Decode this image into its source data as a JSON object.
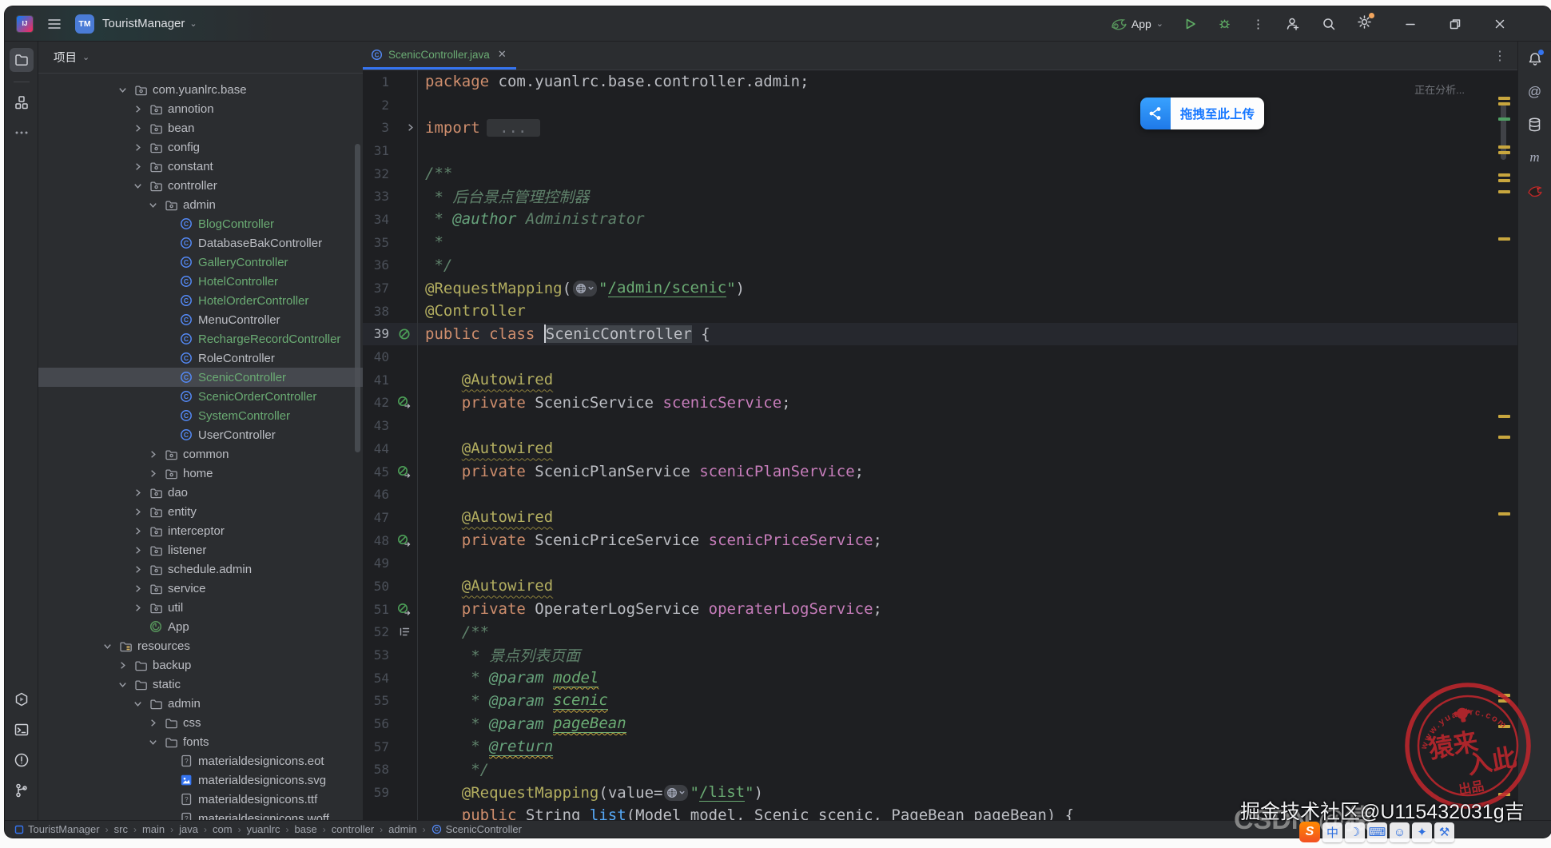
{
  "title_bar": {
    "app_icon_text": "IJ",
    "badge": "TM",
    "project_name": "TouristManager",
    "run_config": "App",
    "analyzing": "正在分析..."
  },
  "project": {
    "header": "项目",
    "tree": [
      {
        "l": "com.yuanlrc.base",
        "v": 1,
        "c": "o",
        "i": "pkg"
      },
      {
        "l": "annotion",
        "v": 2,
        "c": "c",
        "i": "pkg"
      },
      {
        "l": "bean",
        "v": 2,
        "c": "c",
        "i": "pkg"
      },
      {
        "l": "config",
        "v": 2,
        "c": "c",
        "i": "pkg"
      },
      {
        "l": "constant",
        "v": 2,
        "c": "c",
        "i": "pkg"
      },
      {
        "l": "controller",
        "v": 2,
        "c": "o",
        "i": "pkg"
      },
      {
        "l": "admin",
        "v": 3,
        "c": "o",
        "i": "pkg"
      },
      {
        "l": "BlogController",
        "v": 4,
        "c": "",
        "i": "cls",
        "g": true
      },
      {
        "l": "DatabaseBakController",
        "v": 4,
        "c": "",
        "i": "cls"
      },
      {
        "l": "GalleryController",
        "v": 4,
        "c": "",
        "i": "cls",
        "g": true
      },
      {
        "l": "HotelController",
        "v": 4,
        "c": "",
        "i": "cls",
        "g": true
      },
      {
        "l": "HotelOrderController",
        "v": 4,
        "c": "",
        "i": "cls",
        "g": true
      },
      {
        "l": "MenuController",
        "v": 4,
        "c": "",
        "i": "cls"
      },
      {
        "l": "RechargeRecordController",
        "v": 4,
        "c": "",
        "i": "cls",
        "g": true
      },
      {
        "l": "RoleController",
        "v": 4,
        "c": "",
        "i": "cls"
      },
      {
        "l": "ScenicController",
        "v": 4,
        "c": "",
        "i": "cls",
        "g": true,
        "sel": true
      },
      {
        "l": "ScenicOrderController",
        "v": 4,
        "c": "",
        "i": "cls",
        "g": true
      },
      {
        "l": "SystemController",
        "v": 4,
        "c": "",
        "i": "cls",
        "g": true
      },
      {
        "l": "UserController",
        "v": 4,
        "c": "",
        "i": "cls"
      },
      {
        "l": "common",
        "v": 3,
        "c": "c",
        "i": "pkg"
      },
      {
        "l": "home",
        "v": 3,
        "c": "c",
        "i": "pkg"
      },
      {
        "l": "dao",
        "v": 2,
        "c": "c",
        "i": "pkg"
      },
      {
        "l": "entity",
        "v": 2,
        "c": "c",
        "i": "pkg"
      },
      {
        "l": "interceptor",
        "v": 2,
        "c": "c",
        "i": "pkg"
      },
      {
        "l": "listener",
        "v": 2,
        "c": "c",
        "i": "pkg"
      },
      {
        "l": "schedule.admin",
        "v": 2,
        "c": "c",
        "i": "pkg"
      },
      {
        "l": "service",
        "v": 2,
        "c": "c",
        "i": "pkg"
      },
      {
        "l": "util",
        "v": 2,
        "c": "c",
        "i": "pkg"
      },
      {
        "l": "App",
        "v": 2,
        "c": "",
        "i": "boot"
      },
      {
        "l": "resources",
        "v": 0,
        "c": "o",
        "i": "res"
      },
      {
        "l": "backup",
        "v": 1,
        "c": "c",
        "i": "fold"
      },
      {
        "l": "static",
        "v": 1,
        "c": "o",
        "i": "fold"
      },
      {
        "l": "admin",
        "v": 2,
        "c": "o",
        "i": "fold"
      },
      {
        "l": "css",
        "v": 3,
        "c": "c",
        "i": "fold"
      },
      {
        "l": "fonts",
        "v": 3,
        "c": "o",
        "i": "fold"
      },
      {
        "l": "materialdesignicons.eot",
        "v": 4,
        "c": "",
        "i": "fq"
      },
      {
        "l": "materialdesignicons.svg",
        "v": 4,
        "c": "",
        "i": "fi"
      },
      {
        "l": "materialdesignicons.ttf",
        "v": 4,
        "c": "",
        "i": "fq"
      },
      {
        "l": "materialdesignicons.woff",
        "v": 4,
        "c": "",
        "i": "fq"
      }
    ]
  },
  "editor": {
    "tab_label": "ScenicController.java",
    "lines": [
      {
        "n": "1",
        "g": "",
        "s": [
          [
            "kw",
            "package"
          ],
          [
            "pl",
            " com.yuanlrc.base.controller.admin;"
          ]
        ]
      },
      {
        "n": "2",
        "g": "",
        "s": []
      },
      {
        "n": "3",
        "g": "fold",
        "s": [
          [
            "kw",
            "import"
          ],
          [
            "box",
            " ... "
          ]
        ]
      },
      {
        "n": "31",
        "g": "",
        "s": []
      },
      {
        "n": "32",
        "g": "",
        "s": [
          [
            "doc",
            "/**"
          ]
        ]
      },
      {
        "n": "33",
        "g": "",
        "s": [
          [
            "doc",
            " * 后台景点管理控制器"
          ]
        ]
      },
      {
        "n": "34",
        "g": "",
        "s": [
          [
            "doc",
            " * "
          ],
          [
            "dtag",
            "@author"
          ],
          [
            "doc",
            " "
          ],
          [
            "dval",
            "Administrator"
          ]
        ]
      },
      {
        "n": "35",
        "g": "",
        "s": [
          [
            "doc",
            " *"
          ]
        ]
      },
      {
        "n": "36",
        "g": "",
        "s": [
          [
            "doc",
            " */"
          ]
        ]
      },
      {
        "n": "37",
        "g": "",
        "s": [
          [
            "ann",
            "@RequestMapping"
          ],
          [
            "pl",
            "("
          ],
          [
            "ic",
            "globe"
          ],
          [
            "str",
            "\""
          ],
          [
            "stru",
            "/admin/scenic"
          ],
          [
            "str",
            "\""
          ],
          [
            "pl",
            ")"
          ]
        ]
      },
      {
        "n": "38",
        "g": "",
        "s": [
          [
            "ann",
            "@Controller"
          ]
        ]
      },
      {
        "n": "39",
        "g": "bean",
        "cur": true,
        "s": [
          [
            "kw",
            "public"
          ],
          [
            "pl",
            " "
          ],
          [
            "kw",
            "class"
          ],
          [
            "pl",
            " "
          ],
          [
            "ic",
            "caret"
          ],
          [
            "selbox",
            "ScenicController"
          ],
          [
            "pl",
            " {"
          ]
        ]
      },
      {
        "n": "40",
        "g": "",
        "s": []
      },
      {
        "n": "41",
        "g": "",
        "s": [
          [
            "pl",
            "    "
          ],
          [
            "annw",
            "@Autowired"
          ]
        ]
      },
      {
        "n": "42",
        "g": "beanarrow",
        "s": [
          [
            "pl",
            "    "
          ],
          [
            "kw",
            "private"
          ],
          [
            "pl",
            " ScenicService "
          ],
          [
            "fld",
            "scenicService"
          ],
          [
            "pl",
            ";"
          ]
        ]
      },
      {
        "n": "43",
        "g": "",
        "s": []
      },
      {
        "n": "44",
        "g": "",
        "s": [
          [
            "pl",
            "    "
          ],
          [
            "annw",
            "@Autowired"
          ]
        ]
      },
      {
        "n": "45",
        "g": "beanarrow",
        "s": [
          [
            "pl",
            "    "
          ],
          [
            "kw",
            "private"
          ],
          [
            "pl",
            " ScenicPlanService "
          ],
          [
            "fld",
            "scenicPlanService"
          ],
          [
            "pl",
            ";"
          ]
        ]
      },
      {
        "n": "46",
        "g": "",
        "s": []
      },
      {
        "n": "47",
        "g": "",
        "s": [
          [
            "pl",
            "    "
          ],
          [
            "annw",
            "@Autowired"
          ]
        ]
      },
      {
        "n": "48",
        "g": "beanarrow",
        "s": [
          [
            "pl",
            "    "
          ],
          [
            "kw",
            "private"
          ],
          [
            "pl",
            " ScenicPriceService "
          ],
          [
            "fld",
            "scenicPriceService"
          ],
          [
            "pl",
            ";"
          ]
        ]
      },
      {
        "n": "49",
        "g": "",
        "s": []
      },
      {
        "n": "50",
        "g": "",
        "s": [
          [
            "pl",
            "    "
          ],
          [
            "annw",
            "@Autowired"
          ]
        ]
      },
      {
        "n": "51",
        "g": "beanarrow",
        "s": [
          [
            "pl",
            "    "
          ],
          [
            "kw",
            "private"
          ],
          [
            "pl",
            " OperaterLogService "
          ],
          [
            "fld",
            "operaterLogService"
          ],
          [
            "pl",
            ";"
          ]
        ]
      },
      {
        "n": "52",
        "g": "list",
        "s": [
          [
            "doc",
            "    /**"
          ]
        ]
      },
      {
        "n": "53",
        "g": "",
        "s": [
          [
            "doc",
            "     * 景点列表页面"
          ]
        ]
      },
      {
        "n": "54",
        "g": "",
        "s": [
          [
            "doc",
            "     * "
          ],
          [
            "dtag",
            "@param"
          ],
          [
            "doc",
            " "
          ],
          [
            "dparam",
            "model"
          ]
        ]
      },
      {
        "n": "55",
        "g": "",
        "s": [
          [
            "doc",
            "     * "
          ],
          [
            "dtag",
            "@param"
          ],
          [
            "doc",
            " "
          ],
          [
            "dparam",
            "scenic"
          ]
        ]
      },
      {
        "n": "56",
        "g": "",
        "s": [
          [
            "doc",
            "     * "
          ],
          [
            "dtag",
            "@param"
          ],
          [
            "doc",
            " "
          ],
          [
            "dparam",
            "pageBean"
          ]
        ]
      },
      {
        "n": "57",
        "g": "",
        "s": [
          [
            "doc",
            "     * "
          ],
          [
            "dtagu",
            "@return"
          ]
        ]
      },
      {
        "n": "58",
        "g": "",
        "s": [
          [
            "doc",
            "     */"
          ]
        ]
      },
      {
        "n": "59",
        "g": "",
        "s": [
          [
            "pl",
            "    "
          ],
          [
            "ann",
            "@RequestMapping"
          ],
          [
            "pl",
            "("
          ],
          [
            "val",
            "value="
          ],
          [
            "ic",
            "globe"
          ],
          [
            "str",
            "\""
          ],
          [
            "stru",
            "/list"
          ],
          [
            "str",
            "\""
          ],
          [
            "pl",
            ")"
          ]
        ]
      },
      {
        "n": "",
        "g": "",
        "s": [
          [
            "pl",
            "    "
          ],
          [
            "kw",
            "public"
          ],
          [
            "pl",
            " String "
          ],
          [
            "mth",
            "list"
          ],
          [
            "pl",
            "(Model model, Scenic scenic, PageBean pageBean) {"
          ]
        ]
      }
    ],
    "stripes": [
      [
        33,
        "y"
      ],
      [
        40,
        "y"
      ],
      [
        59,
        "g"
      ],
      [
        94,
        "y"
      ],
      [
        101,
        "y"
      ],
      [
        129,
        "y"
      ],
      [
        136,
        "y"
      ],
      [
        150,
        "y"
      ],
      [
        209,
        "y"
      ],
      [
        431,
        "y"
      ],
      [
        457,
        "y"
      ],
      [
        553,
        "y"
      ],
      [
        780,
        "y"
      ],
      [
        787,
        "y"
      ],
      [
        819,
        "y"
      ],
      [
        904,
        "y"
      ]
    ]
  },
  "status_bar": {
    "project": "TouristManager",
    "path": [
      "src",
      "main",
      "java",
      "com",
      "yuanlrc",
      "base",
      "controller",
      "admin"
    ],
    "class_name": "ScenicController"
  },
  "overlays": {
    "upload_label": "拖拽至此上传",
    "stamp_url": "www.yuanlrc.com",
    "stamp_main_1": "猿来",
    "stamp_main_2": "入此",
    "stamp_sub": "出品",
    "wm_csdn": "CSDN @猿",
    "wm_juejin": "掘金技术社区@U115432031g吉",
    "ime_logo": "S",
    "ime_icons": [
      "中",
      "☽",
      "⌨",
      "☺",
      "✦",
      "⚒"
    ]
  }
}
